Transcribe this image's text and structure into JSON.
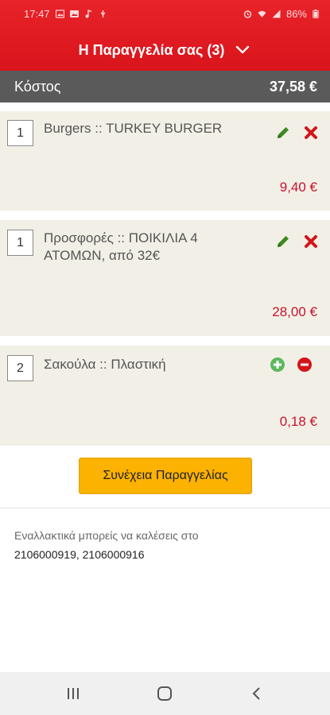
{
  "status_bar": {
    "time": "17:47",
    "battery": "86%"
  },
  "header": {
    "title": "Η Παραγγελία σας (3)"
  },
  "cost": {
    "label": "Κόστος",
    "value": "37,58 €"
  },
  "items": [
    {
      "qty": "1",
      "name": "Burgers :: TURKEY BURGER",
      "price": "9,40 €",
      "actions": [
        "edit-icon",
        "delete-icon"
      ]
    },
    {
      "qty": "1",
      "name": "Προσφορές :: ΠΟΙΚΙΛΙΑ 4 ΑΤΟΜΩΝ, από 32€",
      "price": "28,00 €",
      "actions": [
        "edit-icon",
        "delete-icon"
      ]
    },
    {
      "qty": "2",
      "name": "Σακούλα :: Πλαστική",
      "price": "0,18 €",
      "actions": [
        "plus-icon",
        "minus-icon"
      ]
    }
  ],
  "continue_button": "Συνέχεια Παραγγελίας",
  "alternative": {
    "text": "Εναλλακτικά μπορείς να καλέσεις στο",
    "phones": "2106000919, 2106000916"
  },
  "colors": {
    "header_red": "#e0191f",
    "cost_bar": "#5a5a5a",
    "item_bg": "#f2f0e6",
    "price_red": "#c8102e",
    "button_yellow": "#fbb200",
    "edit_green": "#3c8a1e",
    "delete_red": "#d4141b"
  },
  "nav": [
    "recent-apps-icon",
    "home-icon",
    "back-icon"
  ]
}
